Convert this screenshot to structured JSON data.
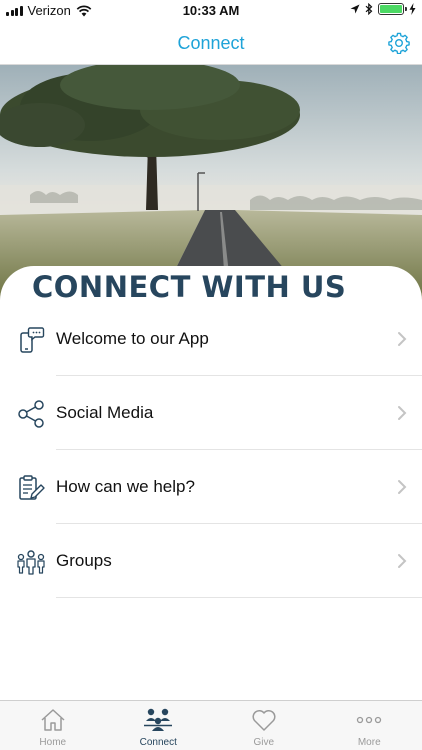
{
  "status_bar": {
    "carrier": "Verizon",
    "time": "10:33 AM",
    "battery_level": 1.0,
    "icons": [
      "signal-icon",
      "wifi-icon",
      "location-icon",
      "bluetooth-icon",
      "battery-icon",
      "charging-icon"
    ]
  },
  "nav": {
    "title": "Connect",
    "settings_icon": "gear-icon"
  },
  "hero": {
    "image": "foggy-road-with-tree"
  },
  "section": {
    "title": "CONNECT WITH US"
  },
  "menu": {
    "items": [
      {
        "label": "Welcome to our App",
        "icon": "phone-chat-icon"
      },
      {
        "label": "Social Media",
        "icon": "share-icon"
      },
      {
        "label": "How can we help?",
        "icon": "clipboard-edit-icon"
      },
      {
        "label": "Groups",
        "icon": "people-group-icon"
      }
    ]
  },
  "tabs": [
    {
      "label": "Home",
      "icon": "home-icon",
      "active": false
    },
    {
      "label": "Connect",
      "icon": "connect-icon",
      "active": true
    },
    {
      "label": "Give",
      "icon": "heart-icon",
      "active": false
    },
    {
      "label": "More",
      "icon": "more-dots-icon",
      "active": false
    }
  ],
  "colors": {
    "accent": "#1ea3d8",
    "title_navy": "#27465e",
    "inactive_tab": "#9a9a9a"
  }
}
